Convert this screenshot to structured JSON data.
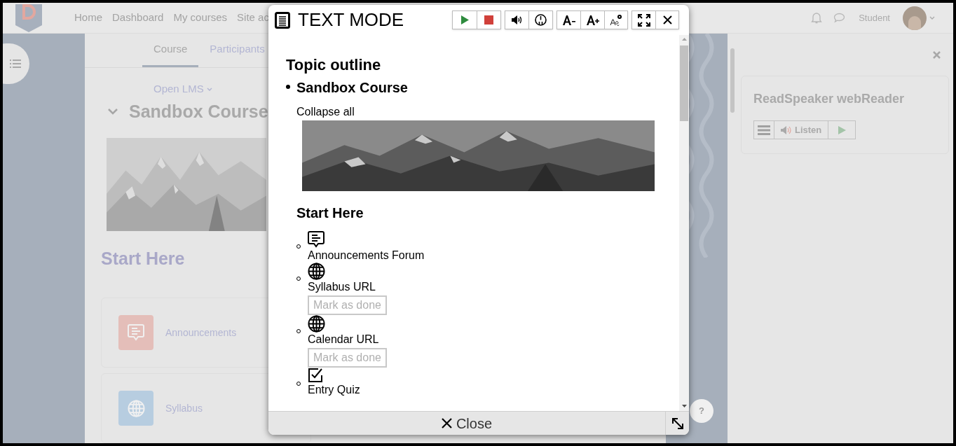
{
  "nav": {
    "links": [
      "Home",
      "Dashboard",
      "My courses",
      "Site ac"
    ],
    "user": "Student"
  },
  "course_tabs": [
    {
      "label": "Course",
      "selected": true
    },
    {
      "label": "Participants",
      "selected": false
    }
  ],
  "breadcrumb": "Open LMS",
  "course_title": "Sandbox Course",
  "section_title": "Start Here",
  "activities": [
    {
      "label": "Announcements",
      "kind": "forum"
    },
    {
      "label": "Syllabus",
      "kind": "url"
    }
  ],
  "side_panel": {
    "title": "ReadSpeaker webReader",
    "listen": "Listen"
  },
  "help": "?",
  "text_mode": {
    "title": "TEXT MODE",
    "heading": "Topic outline",
    "course": "Sandbox Course",
    "collapse": "Collapse all",
    "section": "Start Here",
    "items": [
      {
        "kind": "forum",
        "label": "Announcements Forum"
      },
      {
        "kind": "url",
        "label": "Syllabus URL",
        "button": "Mark as done"
      },
      {
        "kind": "url",
        "label": "Calendar URL",
        "button": "Mark as done"
      },
      {
        "kind": "quiz",
        "label": "Entry Quiz"
      }
    ],
    "close": "Close"
  }
}
